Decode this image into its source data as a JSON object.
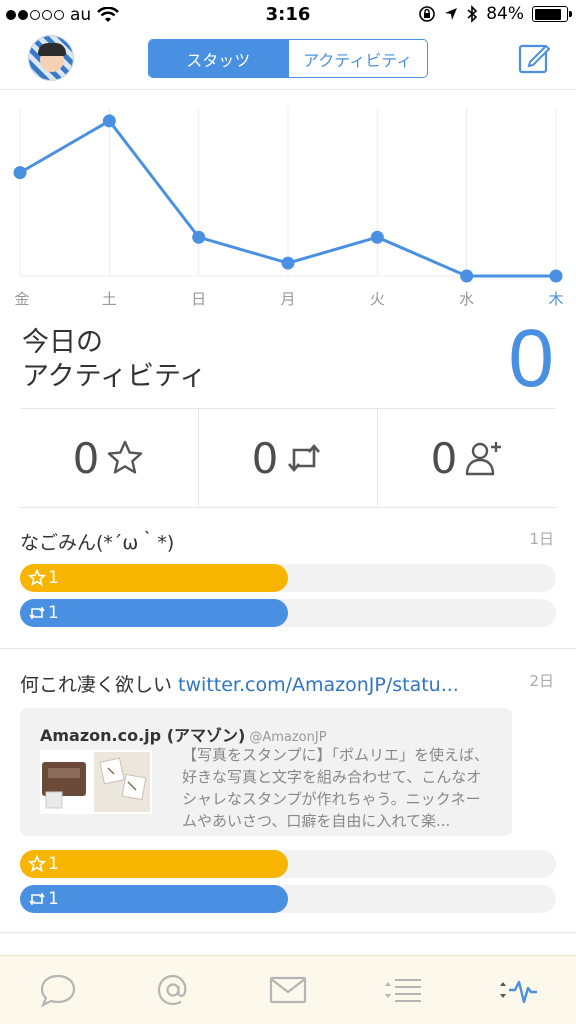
{
  "status_bar": {
    "carrier": "au",
    "time": "3:16",
    "battery": "84%",
    "battery_level": 0.84,
    "signal_bars": 2
  },
  "nav": {
    "tabs": [
      {
        "label": "スタッツ",
        "active": true
      },
      {
        "label": "アクティビティ",
        "active": false
      }
    ]
  },
  "chart_data": {
    "type": "line",
    "categories": [
      "金",
      "土",
      "日",
      "月",
      "火",
      "水",
      "木"
    ],
    "series": [
      {
        "values": [
          4,
          6,
          1.5,
          0.5,
          1.5,
          0,
          0
        ]
      }
    ],
    "ylim": [
      0,
      6.5
    ],
    "highlight_category": "木",
    "line_color": "#4a90e2",
    "grid": true
  },
  "today": {
    "label_line1": "今日の",
    "label_line2": "アクティビティ",
    "count": "0"
  },
  "stats": [
    {
      "value": "0",
      "icon": "star-icon"
    },
    {
      "value": "0",
      "icon": "retweet-icon"
    },
    {
      "value": "0",
      "icon": "add-follower-icon"
    }
  ],
  "activities": [
    {
      "text": "なごみん(*´ω｀*)",
      "date": "1日",
      "favorites": "1",
      "retweets": "1",
      "fav_fraction": 0.5,
      "rt_fraction": 0.5
    },
    {
      "text": "何これ凄く欲しい ",
      "link": "twitter.com/AmazonJP/statu...",
      "date": "2日",
      "card": {
        "title": "Amazon.co.jp (アマゾン)",
        "handle": "@AmazonJP",
        "body": "【写真をスタンプに】「ポムリエ」を使えば、好きな写真と文字を組み合わせて、こんなオシャレなスタンプが作れちゃう。ニックネームやあいさつ、口癖を自由に入れて楽..."
      },
      "favorites": "1",
      "retweets": "1",
      "fav_fraction": 0.5,
      "rt_fraction": 0.5
    }
  ],
  "tab_bar": {
    "items": [
      "chat-bubble-icon",
      "mention-icon",
      "mail-icon",
      "list-icon",
      "activity-icon"
    ],
    "active": "activity-icon",
    "accent": "#4a90e2",
    "inactive_color": "#b5b5b5"
  }
}
